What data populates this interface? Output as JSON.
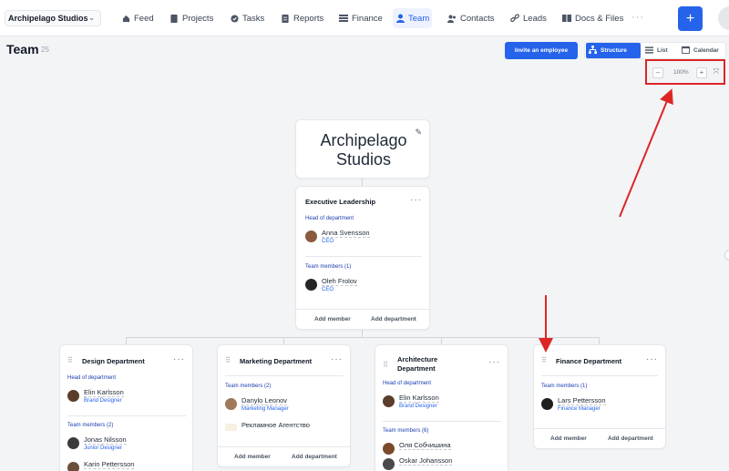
{
  "header": {
    "company": "Archipelago Studios",
    "nav": [
      {
        "label": "Feed",
        "icon": "home-icon"
      },
      {
        "label": "Projects",
        "icon": "document-icon"
      },
      {
        "label": "Tasks",
        "icon": "check-circle-icon"
      },
      {
        "label": "Reports",
        "icon": "report-icon"
      },
      {
        "label": "Finance",
        "icon": "finance-icon"
      },
      {
        "label": "Team",
        "icon": "person-icon"
      },
      {
        "label": "Contacts",
        "icon": "contacts-icon"
      },
      {
        "label": "Leads",
        "icon": "link-icon"
      },
      {
        "label": "Docs & Files",
        "icon": "book-icon"
      }
    ],
    "active_nav": "Team",
    "more": "···",
    "plus": "+"
  },
  "page": {
    "title": "Team",
    "count": "25",
    "invite_label": "Invite an employee",
    "views": [
      "Structure",
      "List",
      "Calendar"
    ],
    "active_view": "Structure",
    "zoom": {
      "minus": "–",
      "value": "100%",
      "plus": "+",
      "fit": "⤧"
    }
  },
  "org": {
    "company_name": "Archipelago Studios",
    "executive": {
      "title": "Executive Leadership",
      "head_label": "Head of department",
      "head": {
        "name": "Anna Svensson",
        "role": "CEO"
      },
      "members_label": "Team members (1)",
      "members": [
        {
          "name": "Oleh Frolov",
          "role": "CEO"
        }
      ],
      "add_member": "Add member",
      "add_department": "Add department"
    },
    "design": {
      "title": "Design Department",
      "head_label": "Head of department",
      "head": {
        "name": "Elin Karlsson",
        "role": "Brand Designer"
      },
      "members_label": "Team members (2)",
      "members": [
        {
          "name": "Jonas Nilsson",
          "role": "Junior Designer"
        },
        {
          "name": "Karin Pettersson",
          "role": ""
        }
      ]
    },
    "marketing": {
      "title": "Marketing Department",
      "members_label": "Team members (2)",
      "members": [
        {
          "name": "Danylo Leonov",
          "role": "Marketing Manager"
        },
        {
          "name": "Рекламное Агентство",
          "role": ""
        }
      ],
      "add_member": "Add member",
      "add_department": "Add department"
    },
    "architecture": {
      "title_line1": "Architecture",
      "title_line2": "Department",
      "head_label": "Head of department",
      "head": {
        "name": "Elin Karlsson",
        "role": "Brand Designer"
      },
      "members_label": "Team members (6)",
      "members": [
        {
          "name": "Оля Собчишина",
          "role": ""
        },
        {
          "name": "Oskar Johansson",
          "role": ""
        }
      ]
    },
    "finance": {
      "title": "Finance Department",
      "members_label": "Team members (1)",
      "members": [
        {
          "name": "Lars Pettersson",
          "role": "Finance Manager"
        }
      ],
      "add_member": "Add member",
      "add_department": "Add department"
    }
  }
}
